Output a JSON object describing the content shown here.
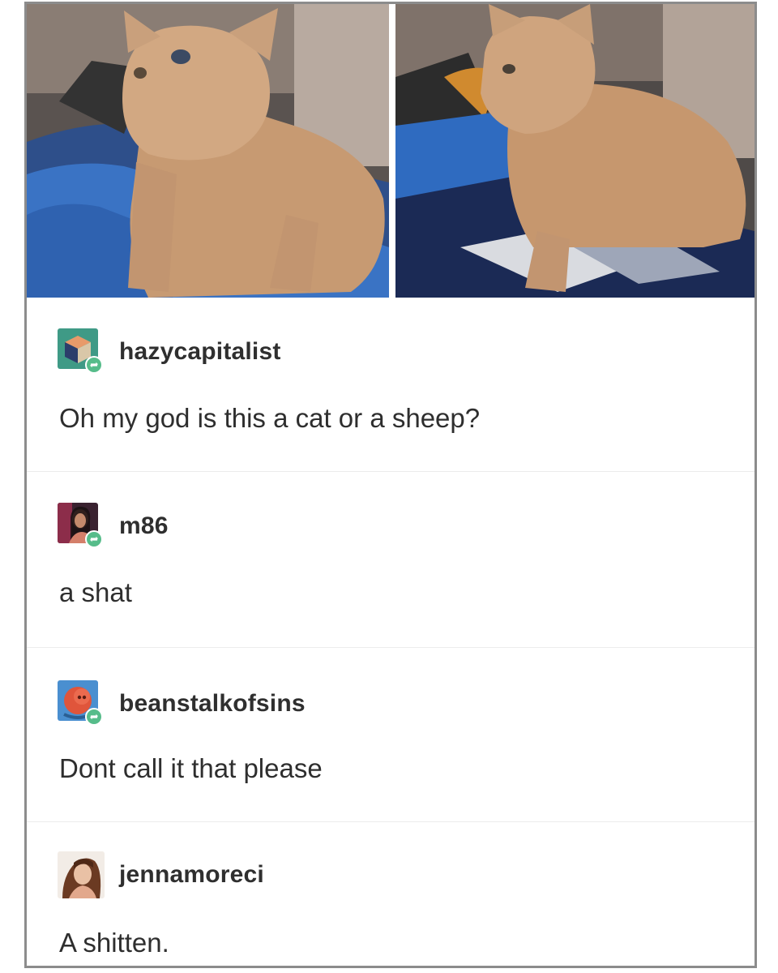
{
  "photos": [
    {
      "name": "curly-kitten-photo-1"
    },
    {
      "name": "curly-kitten-photo-2"
    }
  ],
  "posts": [
    {
      "username": "hazycapitalist",
      "avatar_icon": "cube-avatar-icon",
      "text": "Oh my god is this a cat or a sheep?"
    },
    {
      "username": "m86",
      "avatar_icon": "woman-avatar-icon",
      "text": "a shat"
    },
    {
      "username": "beanstalkofsins",
      "avatar_icon": "face-avatar-icon",
      "text": "Dont call it that please"
    },
    {
      "username": "jennamoreci",
      "avatar_icon": "woman-avatar-icon",
      "text": "A shitten."
    }
  ],
  "reblog_icon": "reblog-icon",
  "colors": {
    "reblog_badge": "#56bc8a",
    "frame_border": "#8c8c8c",
    "divider": "#ececec"
  }
}
